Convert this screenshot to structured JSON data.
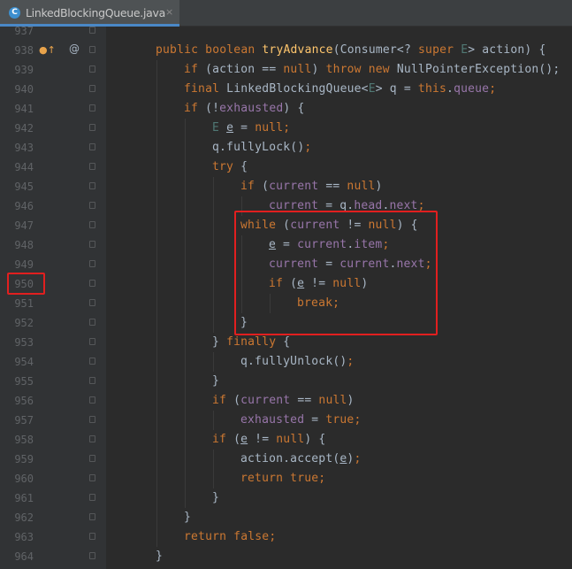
{
  "tab": {
    "icon_letter": "C",
    "filename": "LinkedBlockingQueue.java",
    "close_label": "×"
  },
  "gutter": {
    "override_marker": "●↑",
    "annotation_marker": "@"
  },
  "lines": [
    {
      "num": "937",
      "indent": 0,
      "tokens": []
    },
    {
      "num": "938",
      "indent": 1,
      "tokens": [
        [
          "kw",
          "public boolean "
        ],
        [
          "fn",
          "tryAdvance"
        ],
        [
          "p",
          "(Consumer<? "
        ],
        [
          "kw",
          "super "
        ],
        [
          "tp",
          "E"
        ],
        [
          "p",
          "> action) {"
        ]
      ]
    },
    {
      "num": "939",
      "indent": 2,
      "tokens": [
        [
          "kw",
          "if "
        ],
        [
          "p",
          "(action == "
        ],
        [
          "kw",
          "null"
        ],
        [
          "p",
          ") "
        ],
        [
          "kw",
          "throw new "
        ],
        [
          "p",
          "NullPointerException();"
        ]
      ]
    },
    {
      "num": "940",
      "indent": 2,
      "tokens": [
        [
          "kw",
          "final "
        ],
        [
          "p",
          "LinkedBlockingQueue<"
        ],
        [
          "tp",
          "E"
        ],
        [
          "p",
          "> q = "
        ],
        [
          "kw",
          "this"
        ],
        [
          "p",
          "."
        ],
        [
          "fld",
          "queue"
        ],
        [
          "kw",
          ";"
        ]
      ]
    },
    {
      "num": "941",
      "indent": 2,
      "tokens": [
        [
          "kw",
          "if "
        ],
        [
          "p",
          "(!"
        ],
        [
          "fld",
          "exhausted"
        ],
        [
          "p",
          ") {"
        ]
      ]
    },
    {
      "num": "942",
      "indent": 3,
      "tokens": [
        [
          "tp",
          "E "
        ],
        [
          "u",
          "e"
        ],
        [
          "p",
          " = "
        ],
        [
          "kw",
          "null;"
        ]
      ]
    },
    {
      "num": "943",
      "indent": 3,
      "tokens": [
        [
          "p",
          "q.fullyLock()"
        ],
        [
          "kw",
          ";"
        ]
      ]
    },
    {
      "num": "944",
      "indent": 3,
      "tokens": [
        [
          "kw",
          "try "
        ],
        [
          "p",
          "{"
        ]
      ]
    },
    {
      "num": "945",
      "indent": 4,
      "tokens": [
        [
          "kw",
          "if "
        ],
        [
          "p",
          "("
        ],
        [
          "fld",
          "current"
        ],
        [
          "p",
          " == "
        ],
        [
          "kw",
          "null"
        ],
        [
          "p",
          ")"
        ]
      ]
    },
    {
      "num": "946",
      "indent": 5,
      "tokens": [
        [
          "fld",
          "current"
        ],
        [
          "p",
          " = q."
        ],
        [
          "fld",
          "head"
        ],
        [
          "p",
          "."
        ],
        [
          "fld",
          "next"
        ],
        [
          "kw",
          ";"
        ]
      ]
    },
    {
      "num": "947",
      "indent": 4,
      "tokens": [
        [
          "kw",
          "while "
        ],
        [
          "p",
          "("
        ],
        [
          "fld",
          "current"
        ],
        [
          "p",
          " != "
        ],
        [
          "kw",
          "null"
        ],
        [
          "p",
          ") {"
        ]
      ]
    },
    {
      "num": "948",
      "indent": 5,
      "tokens": [
        [
          "u",
          "e"
        ],
        [
          "p",
          " = "
        ],
        [
          "fld",
          "current"
        ],
        [
          "p",
          "."
        ],
        [
          "fld",
          "item"
        ],
        [
          "kw",
          ";"
        ]
      ]
    },
    {
      "num": "949",
      "indent": 5,
      "tokens": [
        [
          "fld",
          "current"
        ],
        [
          "p",
          " = "
        ],
        [
          "fld",
          "current"
        ],
        [
          "p",
          "."
        ],
        [
          "fld",
          "next"
        ],
        [
          "kw",
          ";"
        ]
      ]
    },
    {
      "num": "950",
      "indent": 5,
      "tokens": [
        [
          "kw",
          "if "
        ],
        [
          "p",
          "("
        ],
        [
          "u",
          "e"
        ],
        [
          "p",
          " != "
        ],
        [
          "kw",
          "null"
        ],
        [
          "p",
          ")"
        ]
      ]
    },
    {
      "num": "951",
      "indent": 6,
      "tokens": [
        [
          "kw",
          "break;"
        ]
      ]
    },
    {
      "num": "952",
      "indent": 4,
      "tokens": [
        [
          "p",
          "}"
        ]
      ]
    },
    {
      "num": "953",
      "indent": 3,
      "tokens": [
        [
          "p",
          "} "
        ],
        [
          "kw",
          "finally "
        ],
        [
          "p",
          "{"
        ]
      ]
    },
    {
      "num": "954",
      "indent": 4,
      "tokens": [
        [
          "p",
          "q.fullyUnlock()"
        ],
        [
          "kw",
          ";"
        ]
      ]
    },
    {
      "num": "955",
      "indent": 3,
      "tokens": [
        [
          "p",
          "}"
        ]
      ]
    },
    {
      "num": "956",
      "indent": 3,
      "tokens": [
        [
          "kw",
          "if "
        ],
        [
          "p",
          "("
        ],
        [
          "fld",
          "current"
        ],
        [
          "p",
          " == "
        ],
        [
          "kw",
          "null"
        ],
        [
          "p",
          ")"
        ]
      ]
    },
    {
      "num": "957",
      "indent": 4,
      "tokens": [
        [
          "fld",
          "exhausted"
        ],
        [
          "p",
          " = "
        ],
        [
          "kw",
          "true;"
        ]
      ]
    },
    {
      "num": "958",
      "indent": 3,
      "tokens": [
        [
          "kw",
          "if "
        ],
        [
          "p",
          "("
        ],
        [
          "u",
          "e"
        ],
        [
          "p",
          " != "
        ],
        [
          "kw",
          "null"
        ],
        [
          "p",
          ") {"
        ]
      ]
    },
    {
      "num": "959",
      "indent": 4,
      "tokens": [
        [
          "p",
          "action.accept("
        ],
        [
          "u",
          "e"
        ],
        [
          "p",
          ")"
        ],
        [
          "kw",
          ";"
        ]
      ]
    },
    {
      "num": "960",
      "indent": 4,
      "tokens": [
        [
          "kw",
          "return true;"
        ]
      ]
    },
    {
      "num": "961",
      "indent": 3,
      "tokens": [
        [
          "p",
          "}"
        ]
      ]
    },
    {
      "num": "962",
      "indent": 2,
      "tokens": [
        [
          "p",
          "}"
        ]
      ]
    },
    {
      "num": "963",
      "indent": 2,
      "tokens": [
        [
          "kw",
          "return false;"
        ]
      ]
    },
    {
      "num": "964",
      "indent": 1,
      "tokens": [
        [
          "p",
          "}"
        ]
      ]
    }
  ],
  "highlights": {
    "code_block_lines": [
      "947",
      "952"
    ],
    "line_number": "950",
    "color": "#e11f1f"
  },
  "colors": {
    "keyword": "#cc7832",
    "method": "#ffc66d",
    "field": "#9876aa",
    "type_param": "#507874",
    "plain": "#a9b7c6",
    "background": "#2b2b2b",
    "gutter": "#313335"
  }
}
